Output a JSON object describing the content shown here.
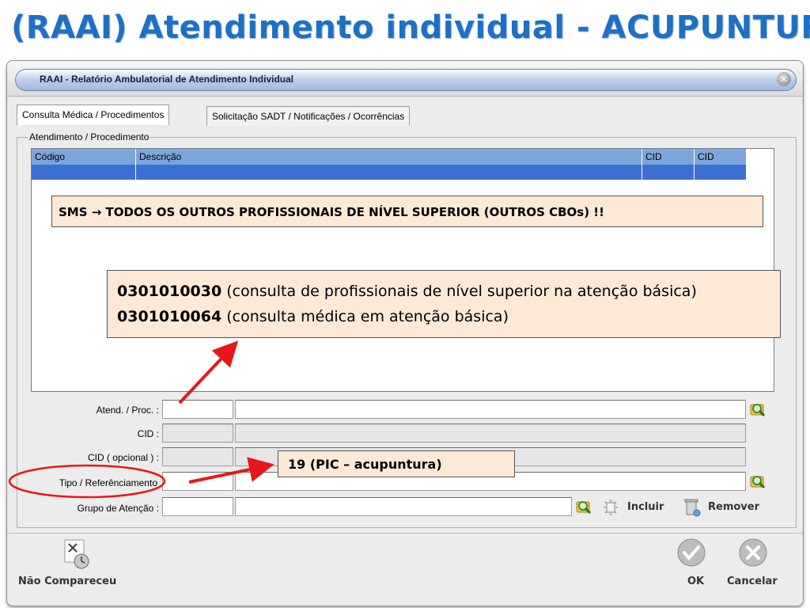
{
  "slide": {
    "title": "(RAAI) Atendimento individual - ACUPUNTURA"
  },
  "window": {
    "title": "RAAI - Relatório Ambulatorial de Atendimento Individual",
    "close_symbol": "✕"
  },
  "tabs": [
    {
      "label": "Consulta Médica /  Procedimentos",
      "active": true
    },
    {
      "label": "Solicitação SADT / Notificações / Ocorrências",
      "active": false
    }
  ],
  "group": {
    "label": "Atendimento / Procedimento"
  },
  "grid": {
    "columns": [
      "Código",
      "Descrição",
      "CID",
      "CID"
    ]
  },
  "annotations": {
    "note1": "SMS → TODOS OS OUTROS PROFISSIONAIS DE NÍVEL SUPERIOR (OUTROS CBOs) !!",
    "note2_lines": [
      {
        "code": "0301010030",
        "text": " (consulta de profissionais de nível superior na atenção básica)"
      },
      {
        "code": "0301010064",
        "text": " (consulta médica em atenção básica)"
      }
    ],
    "note3": "19 (PIC – acupuntura)",
    "arrow_color": "#e8171a",
    "circle_color": "#e8171a"
  },
  "form": {
    "atend_proc_label": "Atend. / Proc. :",
    "cid_label": "CID :",
    "cid_opcional_label": "CID ( opcional ) :",
    "tipo_label": "Tipo / Referênciamento",
    "grupo_label": "Grupo de Atenção :",
    "incluir_label": "Incluir",
    "remover_label": "Remover"
  },
  "footer": {
    "nao_compareceu_label": "Não Compareceu",
    "ok_label": "OK",
    "cancelar_label": "Cancelar"
  },
  "colors": {
    "title_blue": "#1f6fc5",
    "grid_header": "#7ea4dc",
    "grid_selected_row": "#3b6fd4",
    "note_bg": "#fde9d6"
  }
}
